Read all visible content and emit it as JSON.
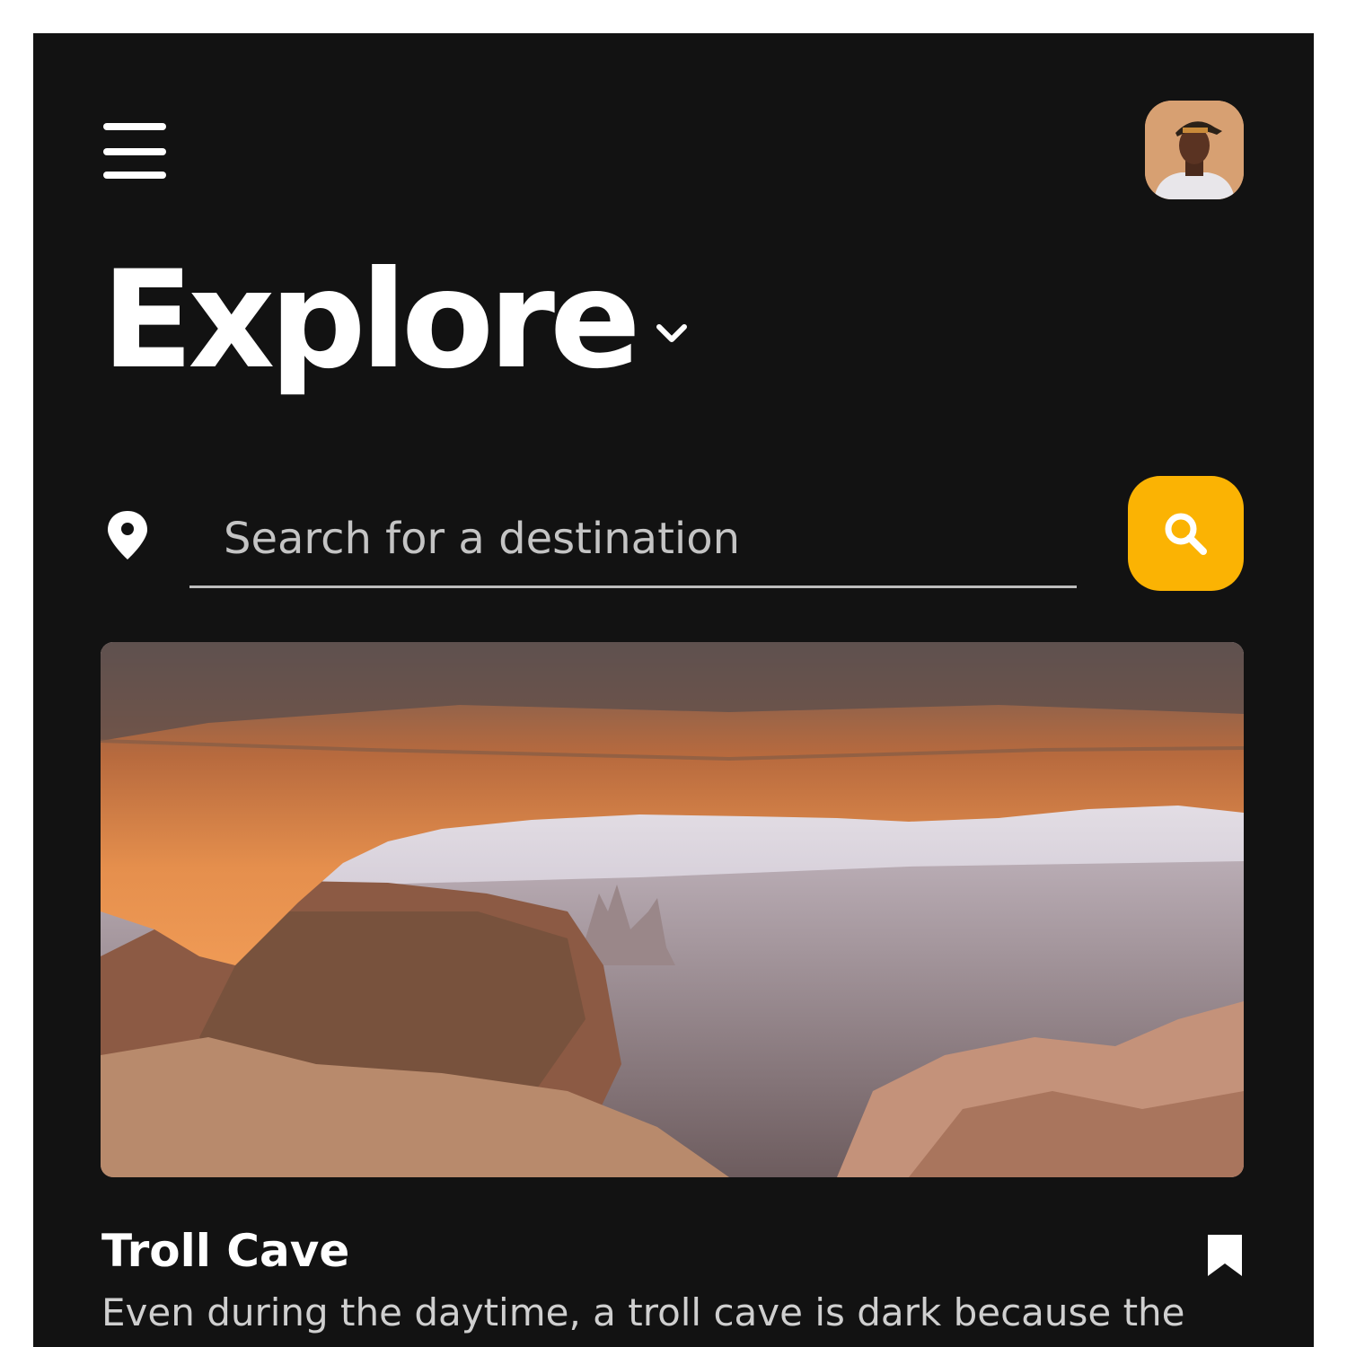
{
  "header": {
    "menu_icon": "hamburger-menu-icon",
    "avatar_icon": "user-avatar"
  },
  "title": {
    "text": "Explore",
    "chevron_icon": "chevron-down-icon"
  },
  "search": {
    "location_icon": "map-pin-icon",
    "placeholder": "Search for a destination",
    "value": "",
    "button_icon": "search-icon"
  },
  "card": {
    "title": "Troll Cave",
    "description": "Even during the daytime, a troll cave is dark because the",
    "bookmark_icon": "bookmark-icon"
  },
  "colors": {
    "background": "#121212",
    "accent": "#fbb303",
    "text": "#ffffff",
    "muted_text": "#cfcfcf"
  }
}
